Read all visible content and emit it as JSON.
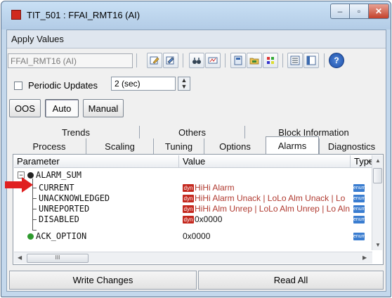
{
  "window": {
    "title": "TIT_501 : FFAI_RMT16 (AI)",
    "minimize_glyph": "–",
    "maximize_glyph": "▫",
    "close_glyph": "✕"
  },
  "menu": {
    "apply_values": "Apply Values"
  },
  "toolbar": {
    "block_name": "FFAI_RMT16 (AI)",
    "icons": [
      "edit-icon",
      "edit-alt-icon",
      "binoculars-icon",
      "compare-icon",
      "faceplate-icon",
      "folder-icon",
      "flags-icon",
      "list-view-icon",
      "table-view-icon",
      "help-icon"
    ],
    "help_glyph": "?"
  },
  "periodic": {
    "label": "Periodic Updates",
    "checked": false,
    "interval": "2 (sec)"
  },
  "modes": {
    "oos": "OOS",
    "auto": "Auto",
    "manual": "Manual",
    "active": "Auto"
  },
  "tabs": {
    "top": [
      "Trends",
      "Others",
      "Block Information"
    ],
    "bottom": [
      "Process",
      "Scaling",
      "Tuning",
      "Options",
      "Alarms",
      "Diagnostics"
    ],
    "selected": "Alarms"
  },
  "grid": {
    "columns": [
      "Parameter",
      "Value",
      "Type"
    ],
    "rows": [
      {
        "param": "ALARM_SUM",
        "value": "",
        "dyn": false,
        "type": ""
      },
      {
        "param": "CURRENT",
        "value": "HiHi Alarm",
        "dyn": true,
        "type": "enum"
      },
      {
        "param": "UNACKNOWLEDGED",
        "value": "HiHi Alarm Unack | LoLo Alm Unack | Lo",
        "dyn": true,
        "type": "enum"
      },
      {
        "param": "UNREPORTED",
        "value": "HiHi Alm Unrep | LoLo Alm Unrep | Lo Aln",
        "dyn": true,
        "type": "enum"
      },
      {
        "param": "DISABLED",
        "value": "0x0000",
        "dyn": true,
        "type": "enum"
      },
      {
        "param": "ACK_OPTION",
        "value": "0x0000",
        "dyn": false,
        "type": "enum"
      }
    ],
    "dyn_label": "dyn",
    "expander_glyph": "−",
    "hscroll_thumb": "III"
  },
  "footer": {
    "write_changes": "Write Changes",
    "read_all": "Read All"
  },
  "colors": {
    "accent_red": "#c4281e",
    "enum_blue": "#3a7dd0",
    "dot_black": "#222222",
    "dot_green": "#2e9a2e"
  }
}
